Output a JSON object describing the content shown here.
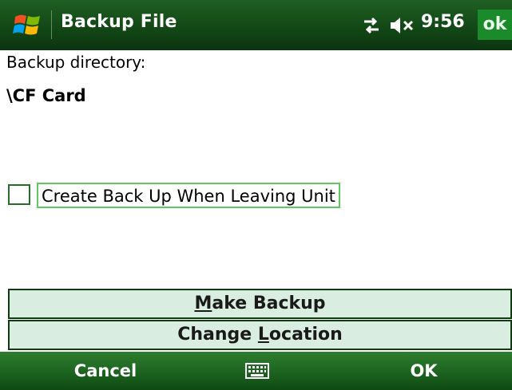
{
  "window": {
    "title": "Backup File",
    "time": "9:56",
    "ok_label": "ok",
    "connection_icon": "connectivity-icon",
    "sound_icon": "speaker-muted-icon",
    "start_icon": "windows-flag-icon"
  },
  "content": {
    "directory_label": "Backup directory:",
    "directory_value": "\\CF Card",
    "checkbox": {
      "label": "Create Back Up When Leaving Unit",
      "checked": false
    }
  },
  "buttons": {
    "make_backup": {
      "mnemonic": "M",
      "rest": "ake Backup"
    },
    "change_location": {
      "before": "Change ",
      "mnemonic": "L",
      "rest": "ocation"
    }
  },
  "softkeys": {
    "left": "Cancel",
    "right": "OK",
    "center_icon": "keyboard-icon"
  },
  "colors": {
    "titlebar": "#134816",
    "button_face": "#d9eee0",
    "ok_highlight": "#1a8a2a",
    "focus_border": "#5fc85f"
  }
}
